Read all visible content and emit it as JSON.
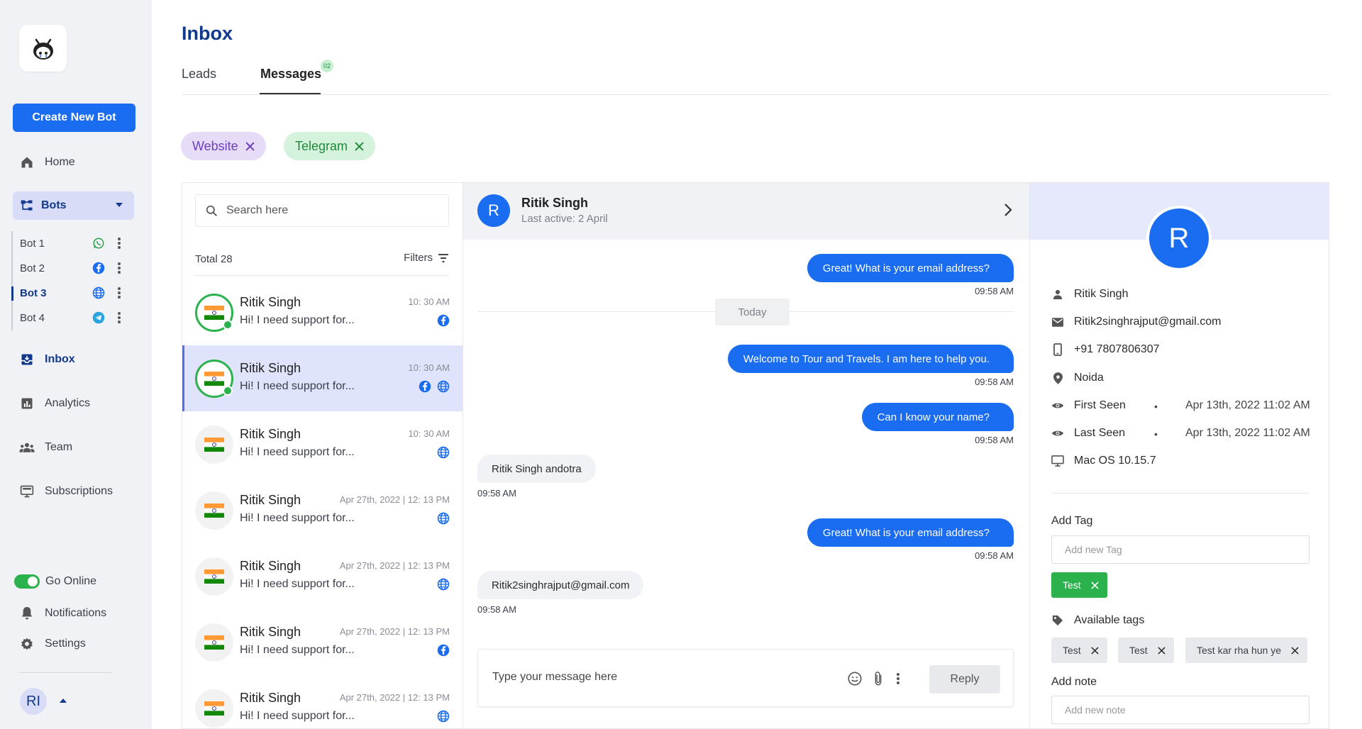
{
  "sidebar": {
    "create_button": "Create New Bot",
    "nav": {
      "home": "Home",
      "bots": "Bots",
      "inbox": "Inbox",
      "analytics": "Analytics",
      "team": "Team",
      "subscriptions": "Subscriptions"
    },
    "bots": [
      {
        "label": "Bot 1",
        "channel": "whatsapp-icon"
      },
      {
        "label": "Bot 2",
        "channel": "facebook-icon"
      },
      {
        "label": "Bot 3",
        "channel": "globe-icon"
      },
      {
        "label": "Bot 4",
        "channel": "telegram-icon"
      }
    ],
    "go_online": "Go Online",
    "notifications": "Notifications",
    "settings": "Settings",
    "user_initials": "RI"
  },
  "header": {
    "title": "Inbox",
    "tabs": [
      {
        "label": "Leads"
      },
      {
        "label": "Messages",
        "badge": "02"
      }
    ]
  },
  "filter_chips": [
    {
      "label": "Website"
    },
    {
      "label": "Telegram"
    }
  ],
  "conversations": {
    "search_placeholder": "Search here",
    "total": "Total 28",
    "filters_label": "Filters",
    "items": [
      {
        "name": "Ritik Singh",
        "message": "Hi! I need support for...",
        "time": "10: 30 AM"
      },
      {
        "name": "Ritik Singh",
        "message": "Hi! I need support for...",
        "time": "10: 30 AM"
      },
      {
        "name": "Ritik Singh",
        "message": "Hi! I need support for...",
        "time": "10: 30 AM"
      },
      {
        "name": "Ritik Singh",
        "message": "Hi! I need support for...",
        "time": "Apr 27th, 2022 | 12: 13 PM"
      },
      {
        "name": "Ritik Singh",
        "message": "Hi! I need support for...",
        "time": "Apr 27th, 2022 | 12: 13 PM"
      },
      {
        "name": "Ritik Singh",
        "message": "Hi! I need support for...",
        "time": "Apr 27th, 2022 | 12: 13 PM"
      },
      {
        "name": "Ritik Singh",
        "message": "Hi! I need support for...",
        "time": "Apr 27th, 2022 | 12: 13 PM"
      }
    ]
  },
  "chat": {
    "initial": "R",
    "name": "Ritik Singh",
    "last_active": "Last active: 2 April",
    "day_separator": "Today",
    "messages": [
      {
        "text": "Great! What is your email address?",
        "time": "09:58 AM"
      },
      {
        "text": "Welcome to Tour and Travels. I am here to help you.",
        "time": "09:58 AM"
      },
      {
        "text": "Can I know your name?",
        "time": "09:58 AM"
      },
      {
        "text": "Ritik Singh andotra",
        "time": "09:58 AM"
      },
      {
        "text": "Great! What is your email address?",
        "time": "09:58 AM"
      },
      {
        "text": "Ritik2singhrajput@gmail.com",
        "time": "09:58 AM"
      }
    ],
    "composer_placeholder": "Type your message here",
    "reply_label": "Reply"
  },
  "profile": {
    "initial": "R",
    "name": "Ritik Singh",
    "email": "Ritik2singhrajput@gmail.com",
    "phone": "+91 7807806307",
    "location": "Noida",
    "first_seen_label": "First Seen",
    "first_seen": "Apr 13th, 2022 11:02 AM",
    "last_seen_label": "Last Seen",
    "last_seen": "Apr 13th, 2022 11:02 AM",
    "os": "Mac OS 10.15.7",
    "separator": "•",
    "add_tag_title": "Add Tag",
    "add_tag_placeholder": "Add new Tag",
    "applied_tags": [
      "Test"
    ],
    "available_tags_title": "Available tags",
    "available_tags": [
      "Test",
      "Test",
      "Test kar rha hun ye"
    ],
    "add_note_title": "Add note",
    "add_note_placeholder": "Add new note"
  },
  "colors": {
    "primary": "#1a6cf0",
    "navy": "#123a8c",
    "green": "#2bb24c",
    "website_chip": "#e6dcf7",
    "telegram_chip": "#d5f2dc"
  }
}
